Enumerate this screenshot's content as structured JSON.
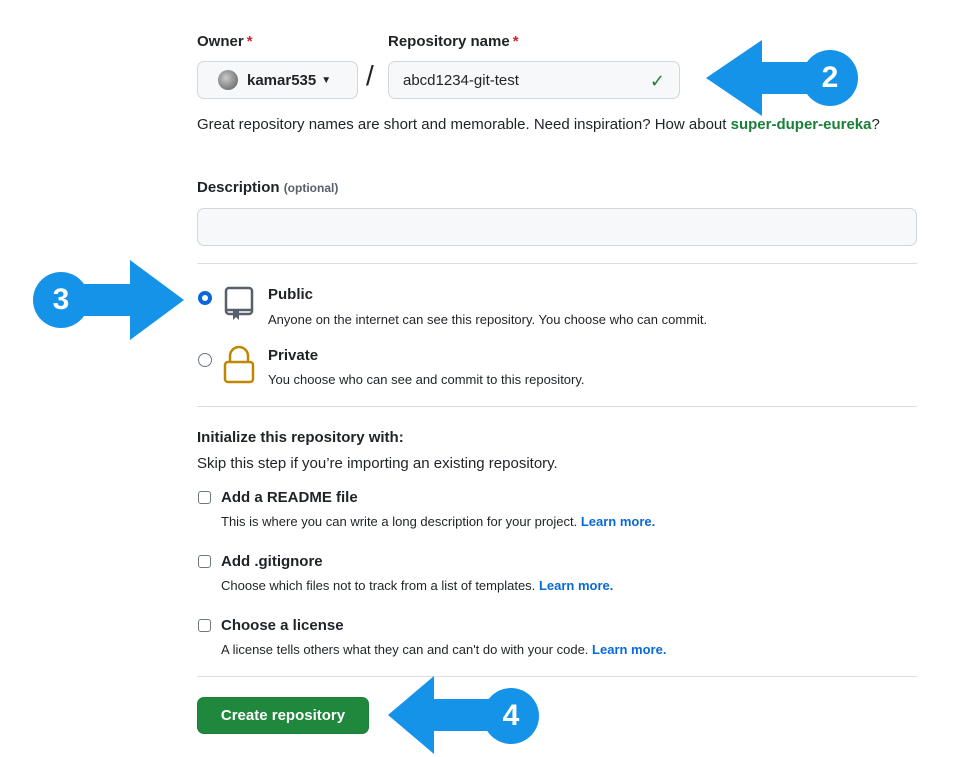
{
  "owner": {
    "label": "Owner",
    "required_mark": "*",
    "value": "kamar535"
  },
  "repo_name": {
    "label": "Repository name",
    "required_mark": "*",
    "value": "abcd1234-git-test",
    "separator": "/"
  },
  "hint": {
    "text": "Great repository names are short and memorable. Need inspiration? How about ",
    "suggestion": "super-duper-eureka",
    "end": "?"
  },
  "description": {
    "label": "Description",
    "optional": "(optional)",
    "value": ""
  },
  "visibility": {
    "public": {
      "title": "Public",
      "subtitle": "Anyone on the internet can see this repository. You choose who can commit.",
      "selected": true
    },
    "private": {
      "title": "Private",
      "subtitle": "You choose who can see and commit to this repository.",
      "selected": false
    }
  },
  "init": {
    "heading": "Initialize this repository with:",
    "subheading": "Skip this step if you’re importing an existing repository.",
    "readme": {
      "title": "Add a README file",
      "desc": "This is where you can write a long description for your project.",
      "link": "Learn more.",
      "checked": false
    },
    "gitignore": {
      "title": "Add .gitignore",
      "desc": "Choose which files not to track from a list of templates.",
      "link": "Learn more.",
      "checked": false
    },
    "license": {
      "title": "Choose a license",
      "desc": "A license tells others what they can and can't do with your code.",
      "link": "Learn more.",
      "checked": false
    }
  },
  "create_button": "Create repository",
  "annotations": {
    "step2": "2",
    "step3": "3",
    "step4": "4",
    "arrow_color": "#1493e8"
  },
  "colors": {
    "accent": "#0969da",
    "success": "#1a7f37",
    "button": "#1f883d",
    "required": "#cf222e"
  }
}
